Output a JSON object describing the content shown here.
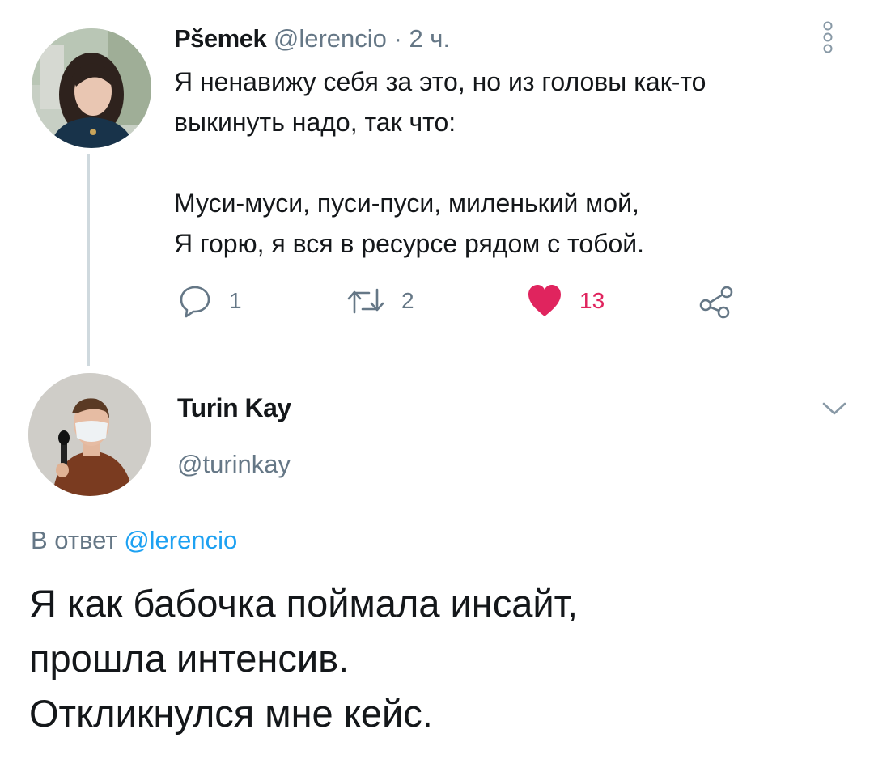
{
  "tweet1": {
    "author_name": "Pšemek",
    "author_handle": "@lerencio",
    "separator": "·",
    "time": "2 ч.",
    "text_lines": [
      "Я ненавижу себя за это, но из головы как-то",
      "выкинуть надо, так что:",
      "",
      "Муси-муси, пуси-пуси, миленький мой,",
      "Я горю, я вся в ресурсе рядом с тобой."
    ],
    "reply_count": "1",
    "retweet_count": "2",
    "like_count": "13"
  },
  "tweet2": {
    "author_name": "Turin Kay",
    "author_handle": "@turinkay",
    "reply_prefix": "В ответ",
    "reply_mention": "@lerencio",
    "text_lines": [
      "Я как бабочка поймала инсайт,",
      "прошла интенсив.",
      "Откликнулся мне кейс."
    ]
  },
  "colors": {
    "primary_text": "#14171a",
    "secondary_text": "#657786",
    "link": "#1da1f2",
    "like_active": "#e0245e",
    "thread_line": "#cfd9de"
  },
  "icons": {
    "more": "vertical-ellipsis-icon",
    "reply": "reply-bubble-icon",
    "retweet": "retweet-icon",
    "like": "heart-filled-icon",
    "share": "share-icon",
    "caret": "chevron-down-icon"
  }
}
